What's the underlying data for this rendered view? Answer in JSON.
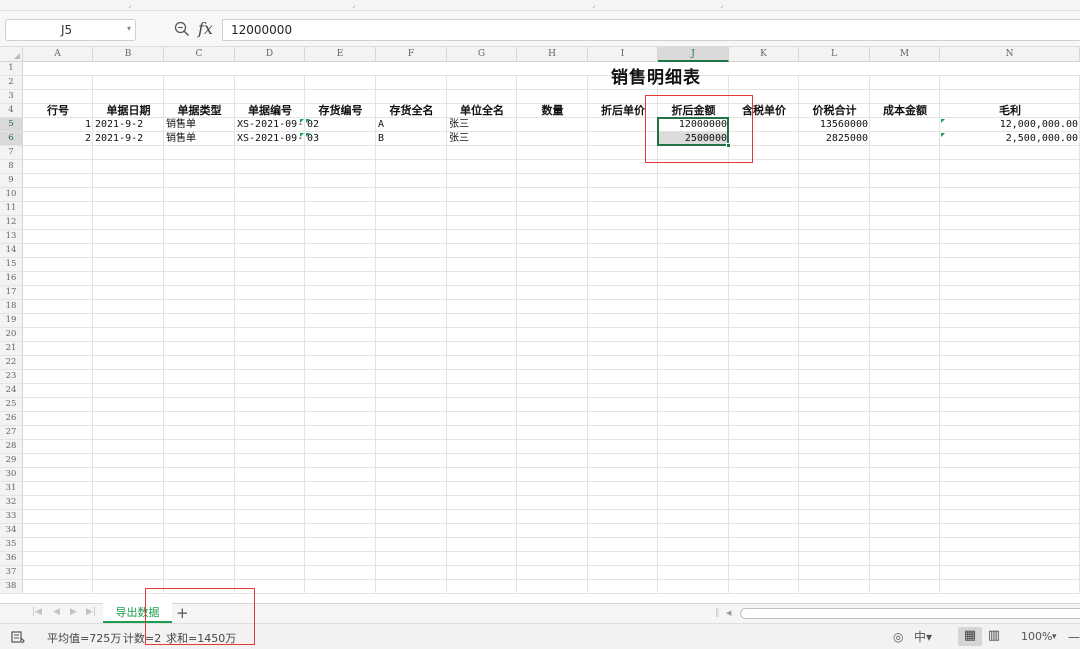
{
  "formula_bar": {
    "cell_ref": "J5",
    "fx_label": "fx",
    "formula": "12000000"
  },
  "sheet": {
    "title": "销售明细表",
    "columns": [
      "A",
      "B",
      "C",
      "D",
      "E",
      "F",
      "G",
      "H",
      "I",
      "J",
      "K",
      "L",
      "M",
      "N"
    ],
    "row_count": 38,
    "headers": [
      "行号",
      "单据日期",
      "单据类型",
      "单据编号",
      "存货编号",
      "存货全名",
      "单位全名",
      "数量",
      "折后单价",
      "折后金额",
      "含税单价",
      "价税合计",
      "成本金额",
      "毛利"
    ],
    "rows": [
      {
        "line": "1",
        "date": "2021-9-2",
        "type": "销售单",
        "doc_no": "XS-2021-09-",
        "item_no": "02",
        "item_name": "A",
        "unit": "张三",
        "qty": "",
        "unit_price": "",
        "amount": "12000000",
        "tax_price": "",
        "total": "13560000",
        "cost": "",
        "profit": "12,000,000.00"
      },
      {
        "line": "2",
        "date": "2021-9-2",
        "type": "销售单",
        "doc_no": "XS-2021-09-",
        "item_no": "03",
        "item_name": "B",
        "unit": "张三",
        "qty": "",
        "unit_price": "",
        "amount": "2500000",
        "tax_price": "",
        "total": "2825000",
        "cost": "",
        "profit": "2,500,000.00"
      }
    ]
  },
  "tabs": {
    "active": "导出数据",
    "add": "+"
  },
  "status": {
    "average": "平均值=725万",
    "count": "计数=2",
    "sum": "求和=1450万",
    "zoom": "100%"
  },
  "colors": {
    "accent": "#217346",
    "tab_green": "#1e9d50",
    "highlight_red": "#e53935"
  }
}
